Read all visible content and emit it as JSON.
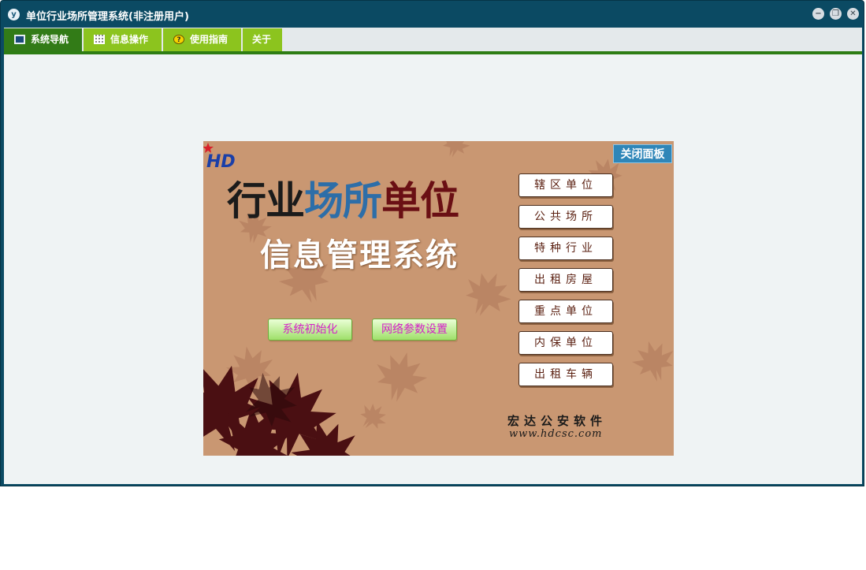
{
  "window": {
    "title": "单位行业场所管理系统(非注册用户)",
    "app_icon_letter": "y",
    "controls": {
      "minimize": "−",
      "restore": "❐",
      "close": "✕"
    }
  },
  "menu": {
    "tabs": [
      {
        "label": "系统导航",
        "icon": "monitor-icon",
        "active": true
      },
      {
        "label": "信息操作",
        "icon": "grid-icon",
        "active": false
      },
      {
        "label": "使用指南",
        "icon": "help-icon",
        "active": false
      },
      {
        "label": "关于",
        "icon": "",
        "active": false
      }
    ],
    "help_glyph": "?"
  },
  "panel": {
    "close_label": "关闭面板",
    "title_part1": "行业",
    "title_part2": "场所",
    "title_part3": "单位",
    "subtitle": "信息管理系统",
    "init_button": "系统初始化",
    "network_button": "网络参数设置",
    "categories": [
      "辖区单位",
      "公共场所",
      "特种行业",
      "出租房屋",
      "重点单位",
      "内保单位",
      "出租车辆"
    ],
    "brand_name": "宏达公安软件",
    "brand_url": "www.hdcsc.com",
    "logo_letters": "HD"
  },
  "colors": {
    "titlebar": "#0b4a63",
    "panel_bg": "#c99772",
    "active_tab": "#327b17",
    "tab_green": "#8cc41e",
    "close_panel": "#2f86b8"
  }
}
